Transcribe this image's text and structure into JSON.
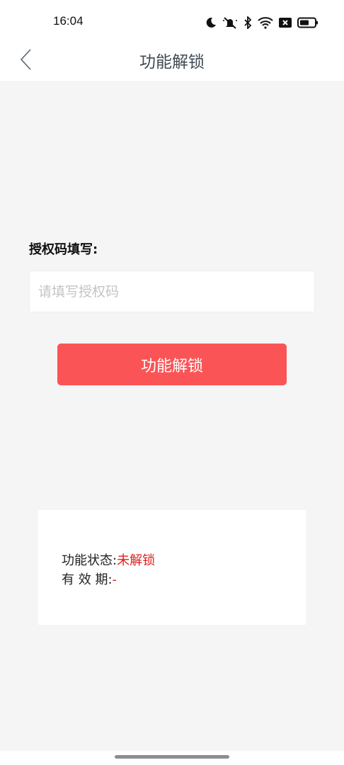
{
  "status_bar": {
    "time": "16:04",
    "icons": [
      "moon-icon",
      "mute-bell-icon",
      "bluetooth-icon",
      "wifi-icon",
      "close-box-icon",
      "battery-icon"
    ]
  },
  "nav": {
    "back_icon": "chevron-left-icon",
    "title": "功能解锁"
  },
  "form": {
    "label": "授权码填写:",
    "input_value": "",
    "input_placeholder": "请填写授权码",
    "button_label": "功能解锁"
  },
  "info": {
    "status_label": "功能状态:",
    "status_value": "未解锁",
    "validity_label": "有 效 期:",
    "validity_value": "-"
  },
  "colors": {
    "accent": "#fb5457",
    "status_value": "#e02020",
    "background": "#f5f5f5"
  }
}
